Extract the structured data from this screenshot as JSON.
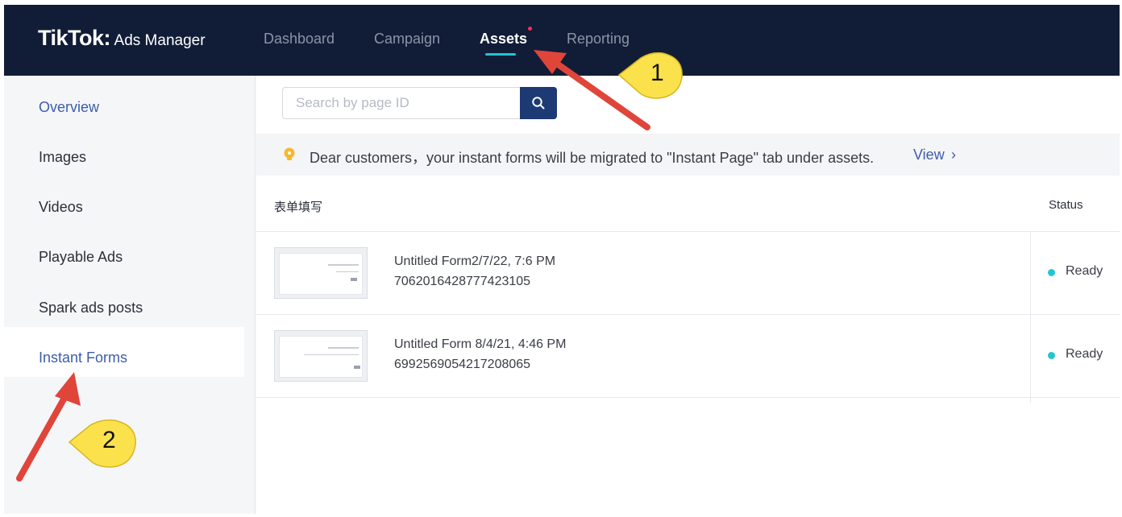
{
  "app": {
    "logo_brand": "TikTok",
    "logo_colon": ":",
    "logo_product": "Ads Manager"
  },
  "nav": {
    "tabs": [
      {
        "label": "Dashboard",
        "active": false
      },
      {
        "label": "Campaign",
        "active": false
      },
      {
        "label": "Assets",
        "active": true
      },
      {
        "label": "Reporting",
        "active": false
      }
    ]
  },
  "sidebar": {
    "items": [
      {
        "label": "Overview"
      },
      {
        "label": "Images"
      },
      {
        "label": "Videos"
      },
      {
        "label": "Playable Ads"
      },
      {
        "label": "Spark ads posts"
      },
      {
        "label": "Instant Forms",
        "active": true
      }
    ]
  },
  "search": {
    "placeholder": "Search by page ID",
    "value": ""
  },
  "notice": {
    "text": "Dear customers，your instant forms will be migrated to \"Instant Page\" tab under assets.",
    "link": "View",
    "chevron": "›"
  },
  "table": {
    "headers": {
      "name": "表单填写",
      "status": "Status"
    },
    "rows": [
      {
        "name": "Untitled Form2/7/22, 7:6 PM",
        "id": "7062016428777423105",
        "status": "Ready"
      },
      {
        "name": "Untitled Form 8/4/21, 4:46 PM",
        "id": "6992569054217208065",
        "status": "Ready"
      }
    ]
  },
  "annotations": {
    "callout_1": "1",
    "callout_2": "2"
  },
  "colors": {
    "topbar": "#111d37",
    "accent_cyan": "#25c4d4",
    "link_blue": "#3d5dab",
    "search_button": "#1e3a74",
    "annotation_arrow": "#e0453a",
    "callout_fill": "#fbe24c"
  },
  "icons": {
    "search_button": "search-icon",
    "notice": "lightbulb-icon",
    "status": "status-dot-icon"
  }
}
